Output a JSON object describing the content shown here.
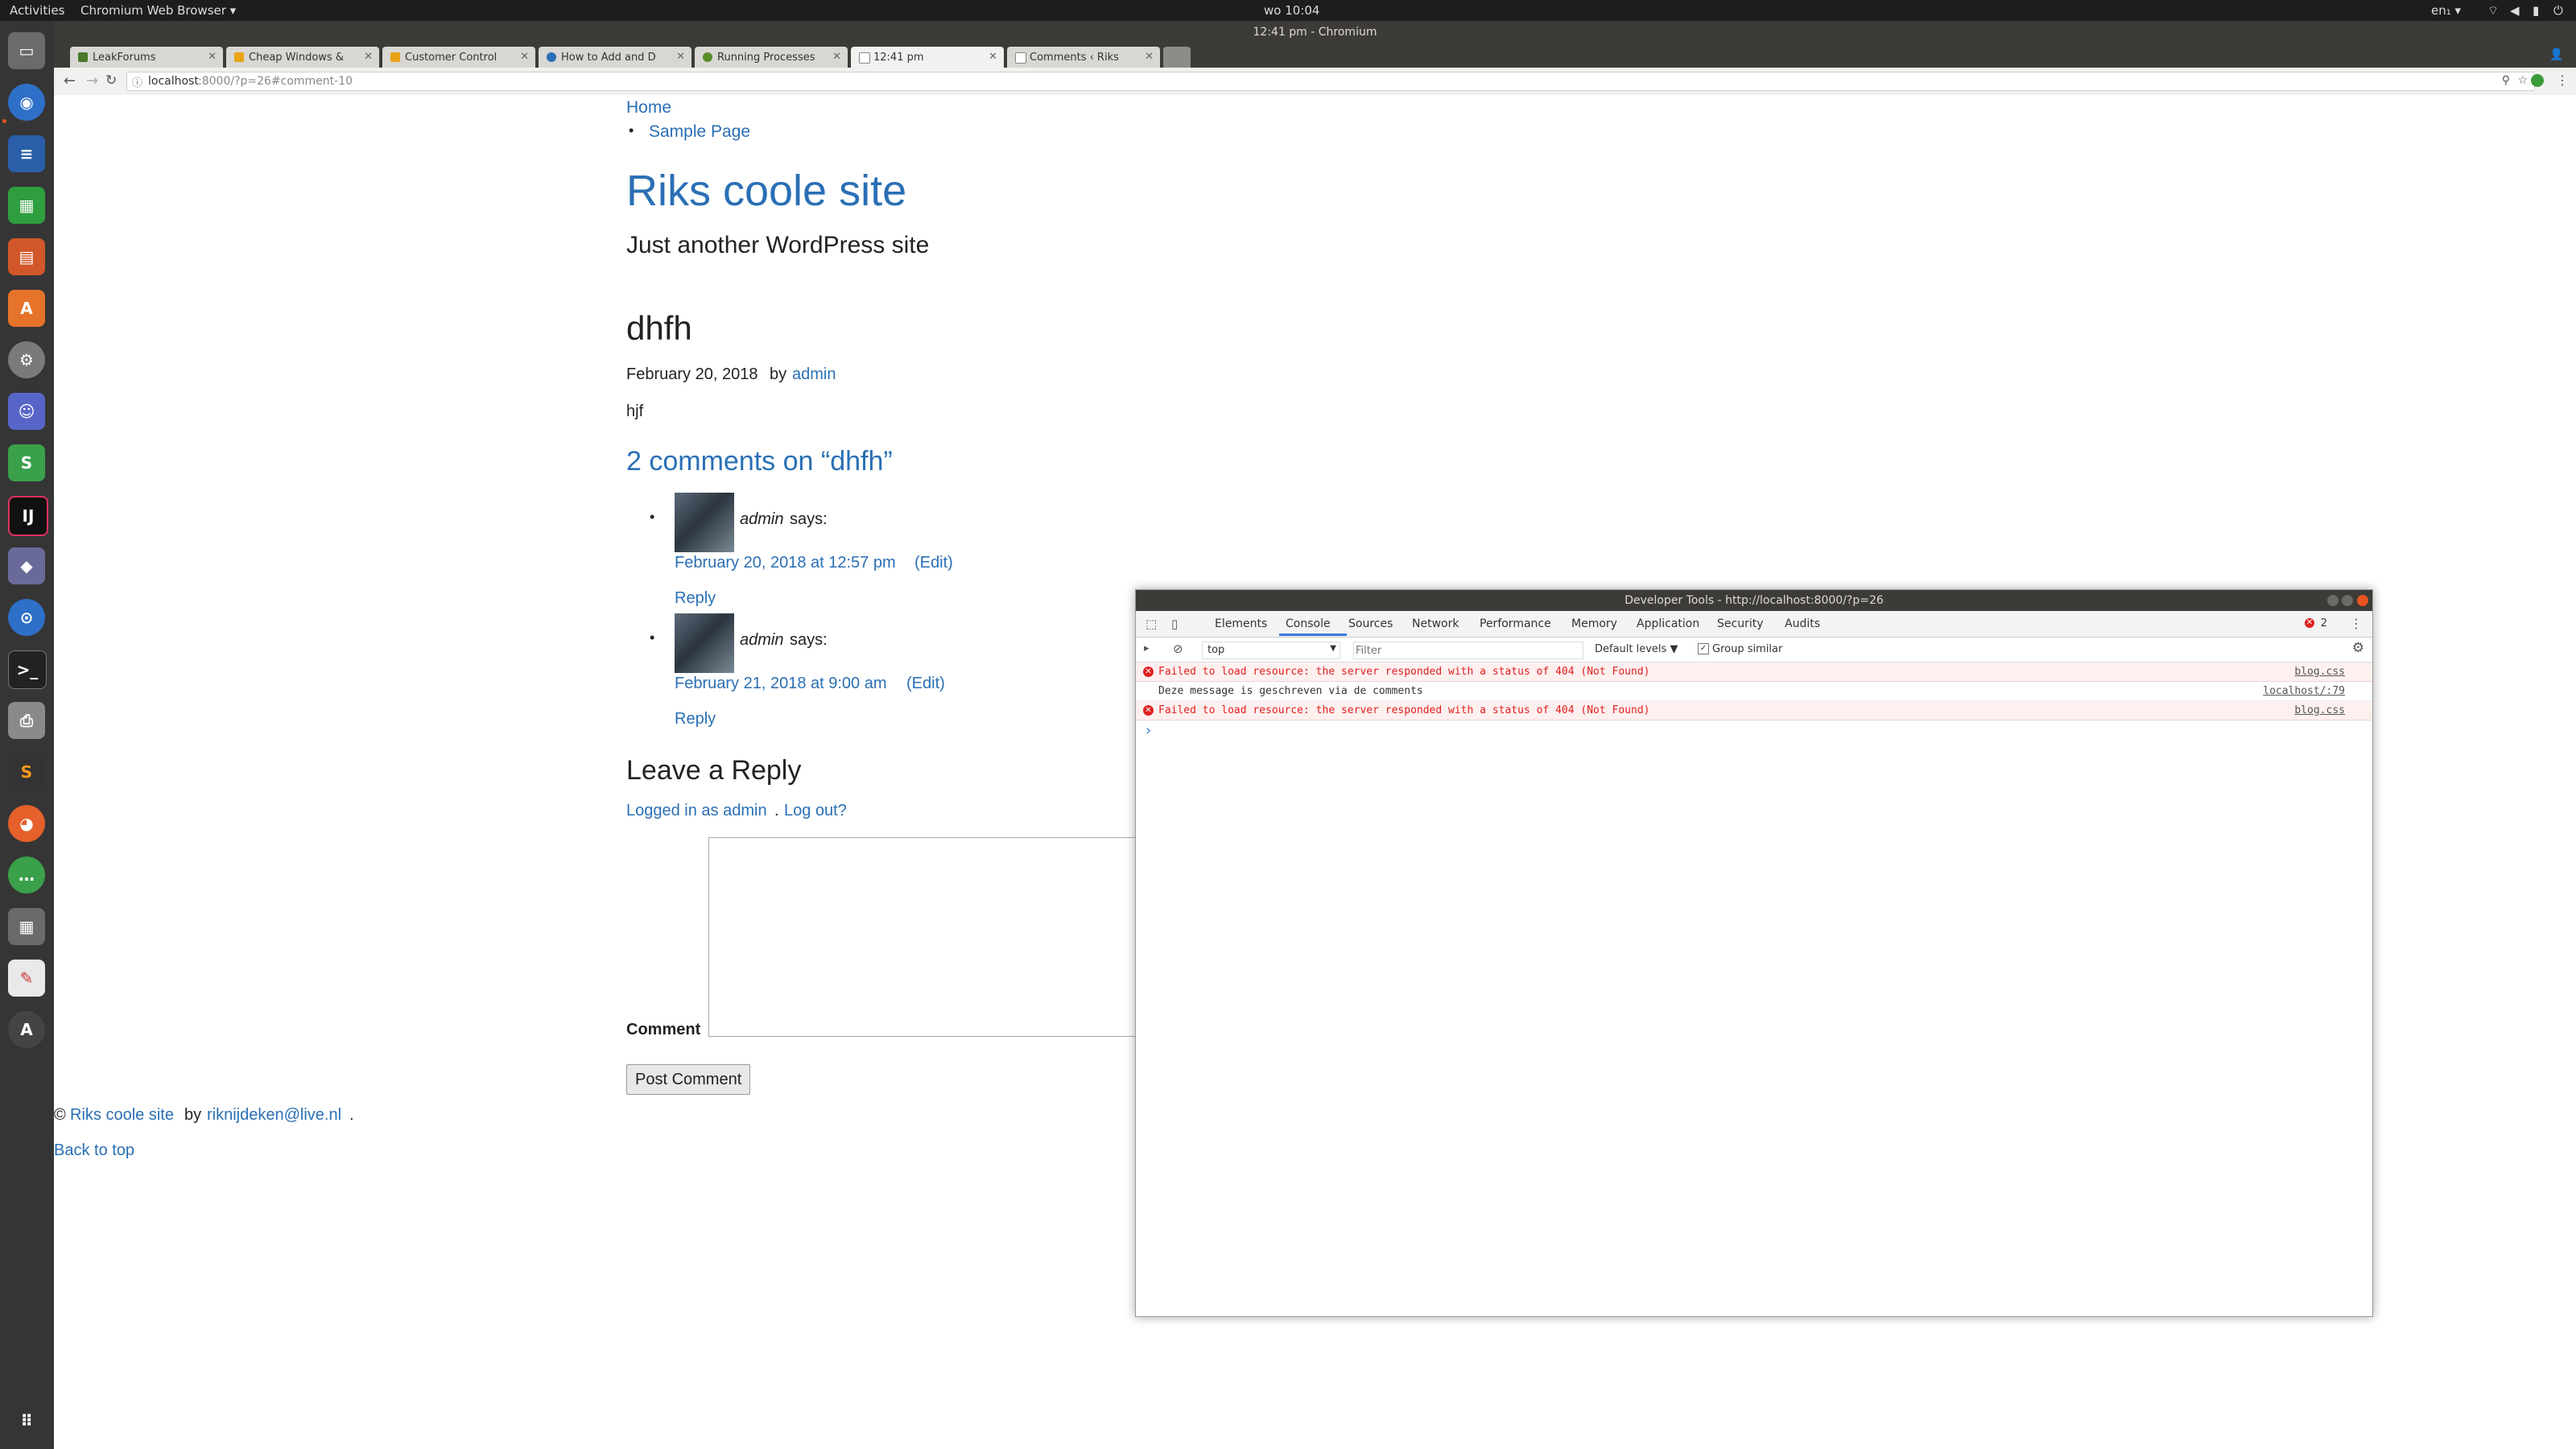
{
  "topbar": {
    "activities": "Activities",
    "app_menu": "Chromium Web Browser ▾",
    "clock": "wo 10:04",
    "lang": "en₁ ▾"
  },
  "window": {
    "title": "12:41 pm - Chromium"
  },
  "tabs": [
    {
      "label": "LeakForums",
      "color": "#4a7a2a"
    },
    {
      "label": "Cheap Windows &",
      "color": "#e8a317"
    },
    {
      "label": "Customer Control",
      "color": "#e8a317"
    },
    {
      "label": "How to Add and D",
      "color": "#2a6fb5"
    },
    {
      "label": "Running Processes",
      "color": "#5b8c2a"
    },
    {
      "label": "12:41 pm",
      "color": "#888888"
    },
    {
      "label": "Comments ‹ Riks",
      "color": "#888888"
    }
  ],
  "address": {
    "host": "localhost",
    "rest": ":8000/?p=26#comment-10"
  },
  "page": {
    "nav_home": "Home",
    "nav_sample": "Sample Page",
    "site_title": "Riks coole site",
    "tagline": "Just another WordPress site",
    "post_title": "dhfh",
    "post_date": "February 20, 2018",
    "by": "by",
    "author": "admin",
    "content": "hjf",
    "comments_heading": "2 comments on “dhfh”",
    "comments": [
      {
        "author": "admin",
        "says": "says:",
        "date": "February 20, 2018 at 12:57 pm",
        "edit": "(Edit)",
        "reply": "Reply"
      },
      {
        "author": "admin",
        "says": "says:",
        "date": "February 21, 2018 at 9:00 am",
        "edit": "(Edit)",
        "reply": "Reply"
      }
    ],
    "leave_reply": "Leave a Reply",
    "logged_in": "Logged in as admin",
    "logout": "Log out?",
    "comment_label": "Comment",
    "post_comment": "Post Comment",
    "footer_copy": "©",
    "footer_site": "Riks coole site",
    "footer_by": "by",
    "footer_email": "riknijdeken@live.nl",
    "back_to_top": "Back to top"
  },
  "devtools": {
    "title": "Developer Tools - http://localhost:8000/?p=26",
    "tabs": [
      "Elements",
      "Console",
      "Sources",
      "Network",
      "Performance",
      "Memory",
      "Application",
      "Security",
      "Audits"
    ],
    "active_tab": "Console",
    "error_count": "2",
    "context": "top",
    "filter_placeholder": "Filter",
    "levels": "Default levels ▼",
    "group_similar": "Group similar",
    "messages": [
      {
        "type": "error",
        "text": "Failed to load resource: the server responded with a status of 404 (Not Found)",
        "source": "blog.css"
      },
      {
        "type": "log",
        "text": "Deze message is geschreven via de comments",
        "source": "localhost/:79"
      },
      {
        "type": "error",
        "text": "Failed to load resource: the server responded with a status of 404 (Not Found)",
        "source": "blog.css"
      }
    ],
    "prompt": "›"
  }
}
